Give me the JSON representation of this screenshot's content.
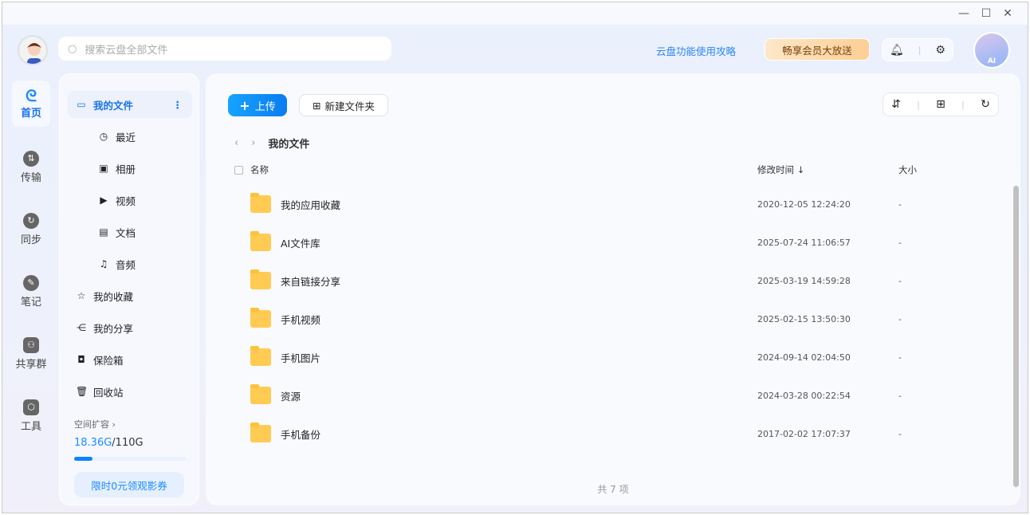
{
  "search": {
    "placeholder": "搜索云盘全部文件"
  },
  "header": {
    "guide_link": "云盘功能使用攻略",
    "vip_button": "畅享会员大放送",
    "ai_label": "AI"
  },
  "rail": [
    {
      "label": "首页",
      "icon": "cloud-icon"
    },
    {
      "label": "传输",
      "icon": "transfer-icon"
    },
    {
      "label": "同步",
      "icon": "sync-icon"
    },
    {
      "label": "笔记",
      "icon": "note-icon"
    },
    {
      "label": "共享群",
      "icon": "group-icon"
    },
    {
      "label": "工具",
      "icon": "toolbox-icon"
    }
  ],
  "sidebar": {
    "items": [
      {
        "label": "我的文件",
        "icon": "folder-icon"
      },
      {
        "label": "最近",
        "icon": "clock-icon"
      },
      {
        "label": "相册",
        "icon": "photo-icon"
      },
      {
        "label": "视频",
        "icon": "video-icon"
      },
      {
        "label": "文档",
        "icon": "document-icon"
      },
      {
        "label": "音频",
        "icon": "headphones-icon"
      },
      {
        "label": "我的收藏",
        "icon": "star-icon"
      },
      {
        "label": "我的分享",
        "icon": "share-icon"
      },
      {
        "label": "保险箱",
        "icon": "safe-icon"
      },
      {
        "label": "回收站",
        "icon": "trash-icon"
      }
    ],
    "expand_label": "空间扩容",
    "storage_used": "18.36G",
    "storage_total": "/110G",
    "storage_fraction": 0.167,
    "promo_button": "限时0元领观影券"
  },
  "toolbar": {
    "upload": "上传",
    "new_folder": "新建文件夹"
  },
  "breadcrumb": {
    "current": "我的文件"
  },
  "table": {
    "headers": {
      "name": "名称",
      "modified": "修改时间",
      "size": "大小"
    },
    "rows": [
      {
        "name": "我的应用收藏",
        "modified": "2020-12-05 12:24:20",
        "size": "-"
      },
      {
        "name": "AI文件库",
        "modified": "2025-07-24 11:06:57",
        "size": "-"
      },
      {
        "name": "来自链接分享",
        "modified": "2025-03-19 14:59:28",
        "size": "-"
      },
      {
        "name": "手机视频",
        "modified": "2025-02-15 13:50:30",
        "size": "-"
      },
      {
        "name": "手机图片",
        "modified": "2024-09-14 02:04:50",
        "size": "-"
      },
      {
        "name": "资源",
        "modified": "2024-03-28 00:22:54",
        "size": "-"
      },
      {
        "name": "手机备份",
        "modified": "2017-02-02 17:07:37",
        "size": "-"
      }
    ],
    "total": "共 7 项"
  }
}
